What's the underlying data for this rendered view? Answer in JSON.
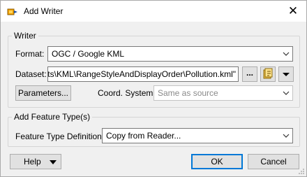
{
  "window": {
    "title": "Add Writer",
    "close_glyph": "✕",
    "app_icon": "fme-writer-icon"
  },
  "writer_group": {
    "legend": "Writer",
    "format_label": "Format:",
    "format_value": "OGC / Google KML",
    "dataset_label": "Dataset:",
    "dataset_value": "C:\\FME\\projects\\KML\\RangeStyleAndDisplayOrder\\Pollution.kml\"",
    "browse_label": "...",
    "parameters_label": "Parameters...",
    "coord_label": "Coord. System:",
    "coord_value": "Same as source"
  },
  "feature_group": {
    "legend": "Add Feature Type(s)",
    "definition_label": "Feature Type Definition:",
    "definition_value": "Copy from Reader..."
  },
  "footer": {
    "help_label": "Help",
    "ok_label": "OK",
    "cancel_label": "Cancel"
  },
  "colors": {
    "dialog_bg": "#f0f0f0",
    "focus_blue": "#0078d7",
    "field_border": "#7a7a7a"
  }
}
